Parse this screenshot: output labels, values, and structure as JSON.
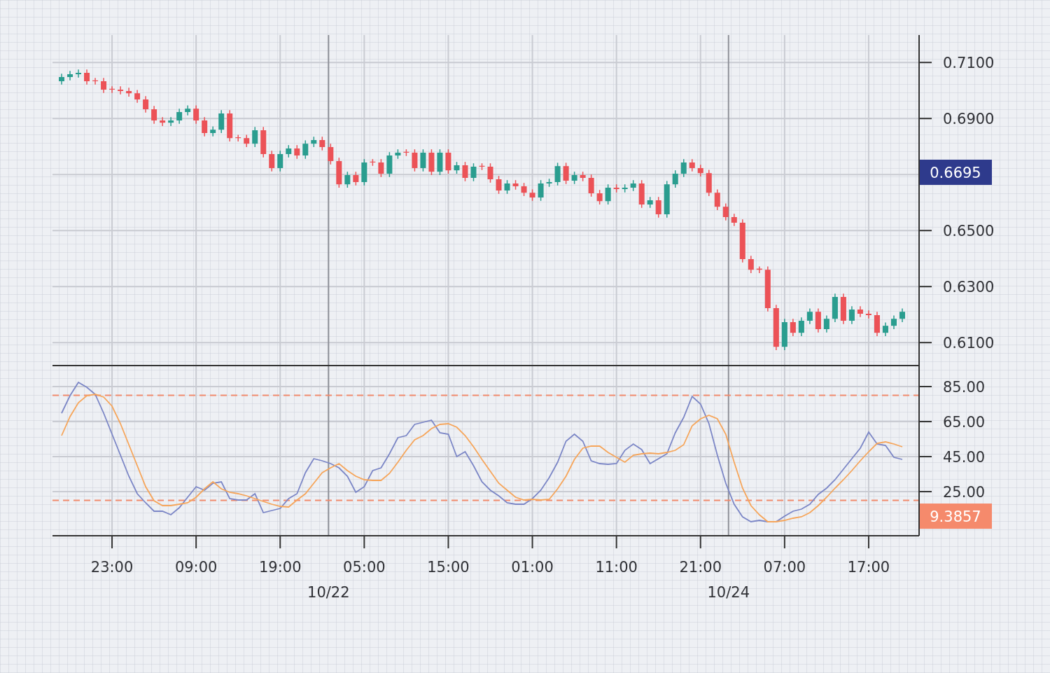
{
  "price_chart": {
    "chart_data": {
      "type": "candlestick",
      "ylim": [
        0.6018,
        0.7198
      ],
      "grid": true,
      "yticks": [
        {
          "value": 0.61,
          "label": "0.6100"
        },
        {
          "value": 0.63,
          "label": "0.6300"
        },
        {
          "value": 0.65,
          "label": "0.6500"
        },
        {
          "value": 0.69,
          "label": "0.6900"
        },
        {
          "value": 0.71,
          "label": "0.7100"
        }
      ],
      "ohlc": [
        [
          0.7033,
          0.706,
          0.7021,
          0.7048
        ],
        [
          0.7048,
          0.707,
          0.7036,
          0.7058
        ],
        [
          0.7058,
          0.7075,
          0.7046,
          0.7063
        ],
        [
          0.7063,
          0.7075,
          0.7021,
          0.7033
        ],
        [
          0.7036,
          0.7045,
          0.7021,
          0.7033
        ],
        [
          0.7033,
          0.7045,
          0.6991,
          0.7003
        ],
        [
          0.7006,
          0.7015,
          0.6991,
          0.7003
        ],
        [
          0.7003,
          0.7015,
          0.6986,
          0.6998
        ],
        [
          0.6998,
          0.701,
          0.6978,
          0.699
        ],
        [
          0.699,
          0.7002,
          0.6956,
          0.6968
        ],
        [
          0.6968,
          0.698,
          0.6921,
          0.6933
        ],
        [
          0.6933,
          0.6945,
          0.6881,
          0.6893
        ],
        [
          0.6893,
          0.6905,
          0.6873,
          0.6885
        ],
        [
          0.6885,
          0.6905,
          0.6873,
          0.6893
        ],
        [
          0.6893,
          0.6935,
          0.6881,
          0.6923
        ],
        [
          0.6923,
          0.6947,
          0.6911,
          0.6935
        ],
        [
          0.6935,
          0.6947,
          0.6881,
          0.6893
        ],
        [
          0.6893,
          0.6905,
          0.6836,
          0.6848
        ],
        [
          0.6848,
          0.6872,
          0.6836,
          0.686
        ],
        [
          0.686,
          0.693,
          0.6848,
          0.6918
        ],
        [
          0.6918,
          0.693,
          0.6818,
          0.683
        ],
        [
          0.6833,
          0.6842,
          0.6818,
          0.683
        ],
        [
          0.683,
          0.6842,
          0.6798,
          0.681
        ],
        [
          0.681,
          0.687,
          0.6798,
          0.6858
        ],
        [
          0.6858,
          0.687,
          0.6761,
          0.6773
        ],
        [
          0.6773,
          0.6785,
          0.6711,
          0.6723
        ],
        [
          0.6723,
          0.6785,
          0.6711,
          0.6773
        ],
        [
          0.6773,
          0.6805,
          0.6761,
          0.6793
        ],
        [
          0.6793,
          0.6805,
          0.6756,
          0.6768
        ],
        [
          0.6768,
          0.6822,
          0.6756,
          0.681
        ],
        [
          0.681,
          0.6835,
          0.6798,
          0.6823
        ],
        [
          0.6823,
          0.6835,
          0.6786,
          0.6798
        ],
        [
          0.6798,
          0.681,
          0.6736,
          0.6748
        ],
        [
          0.6748,
          0.676,
          0.6653,
          0.6665
        ],
        [
          0.6665,
          0.671,
          0.6653,
          0.6698
        ],
        [
          0.6698,
          0.671,
          0.6661,
          0.6673
        ],
        [
          0.6673,
          0.6755,
          0.6661,
          0.6743
        ],
        [
          0.6746,
          0.6755,
          0.6731,
          0.6743
        ],
        [
          0.6743,
          0.6755,
          0.6691,
          0.6703
        ],
        [
          0.6703,
          0.678,
          0.6691,
          0.6768
        ],
        [
          0.6768,
          0.679,
          0.6756,
          0.6778
        ],
        [
          0.6781,
          0.679,
          0.6766,
          0.6778
        ],
        [
          0.6778,
          0.679,
          0.6711,
          0.6723
        ],
        [
          0.6723,
          0.679,
          0.6711,
          0.6778
        ],
        [
          0.6778,
          0.679,
          0.6698,
          0.671
        ],
        [
          0.671,
          0.679,
          0.6698,
          0.6778
        ],
        [
          0.6778,
          0.679,
          0.6703,
          0.6715
        ],
        [
          0.6715,
          0.6745,
          0.6703,
          0.6733
        ],
        [
          0.6733,
          0.6745,
          0.6676,
          0.6688
        ],
        [
          0.6688,
          0.674,
          0.6676,
          0.6728
        ],
        [
          0.6731,
          0.674,
          0.6716,
          0.6728
        ],
        [
          0.6728,
          0.674,
          0.6671,
          0.6683
        ],
        [
          0.6683,
          0.6695,
          0.6631,
          0.6643
        ],
        [
          0.6643,
          0.668,
          0.6631,
          0.6668
        ],
        [
          0.6668,
          0.668,
          0.6646,
          0.6658
        ],
        [
          0.6658,
          0.667,
          0.6623,
          0.6635
        ],
        [
          0.6635,
          0.6647,
          0.6606,
          0.6618
        ],
        [
          0.6618,
          0.668,
          0.6606,
          0.6668
        ],
        [
          0.6668,
          0.6685,
          0.6656,
          0.6673
        ],
        [
          0.6673,
          0.6742,
          0.6661,
          0.673
        ],
        [
          0.673,
          0.6742,
          0.6666,
          0.6678
        ],
        [
          0.6678,
          0.671,
          0.6666,
          0.6698
        ],
        [
          0.6698,
          0.671,
          0.6676,
          0.6688
        ],
        [
          0.6688,
          0.67,
          0.6621,
          0.6633
        ],
        [
          0.6633,
          0.6645,
          0.6593,
          0.6605
        ],
        [
          0.6605,
          0.6665,
          0.6593,
          0.6653
        ],
        [
          0.6653,
          0.6665,
          0.6636,
          0.6648
        ],
        [
          0.6648,
          0.6665,
          0.6636,
          0.6653
        ],
        [
          0.6653,
          0.668,
          0.6641,
          0.6668
        ],
        [
          0.6668,
          0.668,
          0.6581,
          0.6593
        ],
        [
          0.6593,
          0.662,
          0.6581,
          0.6608
        ],
        [
          0.6608,
          0.662,
          0.6546,
          0.6558
        ],
        [
          0.6558,
          0.6677,
          0.6546,
          0.6665
        ],
        [
          0.6665,
          0.6715,
          0.6653,
          0.6703
        ],
        [
          0.6703,
          0.6755,
          0.6691,
          0.6743
        ],
        [
          0.6743,
          0.6755,
          0.6711,
          0.6723
        ],
        [
          0.6723,
          0.6735,
          0.6693,
          0.6705
        ],
        [
          0.6705,
          0.6717,
          0.6623,
          0.6635
        ],
        [
          0.6635,
          0.6647,
          0.6573,
          0.6585
        ],
        [
          0.6585,
          0.6597,
          0.6536,
          0.6548
        ],
        [
          0.6548,
          0.656,
          0.6516,
          0.6528
        ],
        [
          0.6528,
          0.654,
          0.6386,
          0.6398
        ],
        [
          0.6398,
          0.641,
          0.6348,
          0.636
        ],
        [
          0.6364,
          0.6372,
          0.6348,
          0.636
        ],
        [
          0.636,
          0.6372,
          0.6211,
          0.6223
        ],
        [
          0.6223,
          0.6235,
          0.6073,
          0.6085
        ],
        [
          0.6085,
          0.6185,
          0.6073,
          0.6173
        ],
        [
          0.6173,
          0.6185,
          0.6123,
          0.6135
        ],
        [
          0.6135,
          0.619,
          0.6123,
          0.6178
        ],
        [
          0.6178,
          0.6222,
          0.6166,
          0.621
        ],
        [
          0.621,
          0.6222,
          0.6136,
          0.6148
        ],
        [
          0.6148,
          0.6197,
          0.6136,
          0.6185
        ],
        [
          0.6185,
          0.6275,
          0.6173,
          0.6263
        ],
        [
          0.6263,
          0.6275,
          0.6166,
          0.6178
        ],
        [
          0.6178,
          0.623,
          0.6166,
          0.6218
        ],
        [
          0.6218,
          0.623,
          0.6191,
          0.6203
        ],
        [
          0.6203,
          0.6215,
          0.6186,
          0.6198
        ],
        [
          0.6198,
          0.621,
          0.6123,
          0.6135
        ],
        [
          0.6135,
          0.6172,
          0.6123,
          0.616
        ],
        [
          0.616,
          0.6197,
          0.6148,
          0.6185
        ],
        [
          0.6185,
          0.6222,
          0.6173,
          0.621
        ]
      ]
    },
    "current_price": "0.6695"
  },
  "oscillator": {
    "chart_data": {
      "type": "line",
      "grid": true,
      "ylim": [
        -0.2,
        97
      ],
      "categories": [
        null,
        null,
        null,
        null,
        null,
        null,
        "23:00",
        null,
        null,
        null,
        null,
        null,
        null,
        null,
        null,
        null,
        "09:00",
        null,
        null,
        null,
        null,
        null,
        null,
        null,
        null,
        null,
        "19:00",
        null,
        null,
        null,
        null,
        null,
        null,
        null,
        null,
        null,
        "05:00",
        null,
        null,
        null,
        null,
        null,
        null,
        null,
        null,
        null,
        "15:00",
        null,
        null,
        null,
        null,
        null,
        null,
        null,
        null,
        null,
        "01:00",
        null,
        null,
        null,
        null,
        null,
        null,
        null,
        null,
        null,
        "11:00",
        null,
        null,
        null,
        null,
        null,
        null,
        null,
        null,
        null,
        "21:00",
        null,
        null,
        null,
        null,
        null,
        null,
        null,
        null,
        null,
        "07:00",
        null,
        null,
        null,
        null,
        null,
        null,
        null,
        null,
        null,
        "17:00",
        null,
        null,
        null,
        null
      ],
      "yticks": [
        {
          "value": 25,
          "label": "25.00"
        },
        {
          "value": 45,
          "label": "45.00"
        },
        {
          "value": 65,
          "label": "65.00"
        },
        {
          "value": 85,
          "label": "85.00"
        }
      ],
      "series": [
        {
          "color": "#7b86c6",
          "values": [
            69.8,
            79.8,
            87.4,
            84.6,
            80.6,
            69.8,
            57.8,
            45.8,
            33.8,
            23.8,
            18.6,
            13.8,
            13.8,
            11.8,
            15.8,
            21.8,
            27.8,
            25.8,
            29.8,
            30.6,
            21,
            20.2,
            20.2,
            23.8,
            13,
            14.2,
            15.4,
            21,
            23.8,
            35.8,
            43.8,
            42.6,
            41,
            38.6,
            33.8,
            24.6,
            27.8,
            37,
            38.6,
            46.6,
            55.8,
            57,
            63.4,
            64.6,
            65.8,
            58.6,
            57.8,
            45,
            47.8,
            39.8,
            30.6,
            25.8,
            22.6,
            18.6,
            17.8,
            17.8,
            21,
            25.8,
            33,
            41.8,
            53.8,
            57.8,
            53.8,
            42.6,
            41,
            40.6,
            41,
            48.6,
            52.2,
            49,
            41,
            43.8,
            46.6,
            58.6,
            67.4,
            79.4,
            75,
            63.8,
            45.8,
            29.8,
            17.8,
            10.6,
            7.8,
            8.6,
            7.8,
            7.8,
            11,
            13.8,
            15,
            17.8,
            23.4,
            27,
            31.8,
            37.8,
            43.8,
            49.8,
            59,
            52.2,
            51.4,
            44.6,
            43.4
          ]
        },
        {
          "color": "#f6a55a",
          "values": [
            57,
            67.8,
            75.8,
            79.8,
            80.6,
            79,
            73.8,
            63.8,
            51.8,
            39.8,
            27.8,
            19.8,
            17,
            17,
            17.8,
            18.6,
            21.8,
            26.6,
            30.6,
            26.6,
            24.6,
            23.8,
            22.6,
            21,
            19.4,
            17.8,
            16.6,
            16.2,
            20.2,
            23.8,
            29.8,
            35.8,
            38.6,
            41,
            37,
            33.8,
            31.8,
            31.4,
            31.4,
            35.4,
            41.8,
            48.6,
            54.6,
            57,
            61,
            63.4,
            63.8,
            61.8,
            57,
            50.6,
            43.4,
            36.6,
            29.8,
            25.8,
            21.8,
            20.2,
            20.6,
            20.2,
            20.6,
            26.6,
            33.8,
            43.4,
            49.8,
            51,
            51,
            47.4,
            44.6,
            41.8,
            45.8,
            46.6,
            47,
            46.6,
            47.4,
            48.6,
            51.8,
            62.6,
            66.6,
            68.6,
            66.6,
            57.8,
            41.8,
            27,
            17,
            11.8,
            7.8,
            7.8,
            8.6,
            9.8,
            10.6,
            13,
            17,
            21.8,
            27,
            31.8,
            37,
            42.6,
            47.8,
            52.6,
            53.4,
            52.2,
            50.6
          ]
        }
      ],
      "ref_lines": [
        {
          "axis": "y",
          "value": 80
        },
        {
          "axis": "y",
          "value": 20
        }
      ]
    },
    "current_value": "9.3857"
  },
  "time_axis": {
    "date_labels": [
      "10/22",
      "10/24"
    ]
  }
}
